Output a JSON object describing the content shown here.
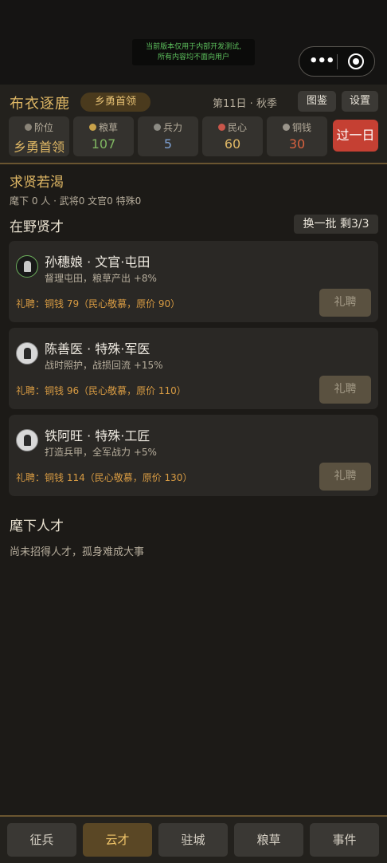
{
  "notice": {
    "line1": "当前版本仅用于内部开发测试,",
    "line2": "所有内容均不面向用户"
  },
  "capsule": {
    "more_icon": "more-dots-icon",
    "close_icon": "target-circle-icon"
  },
  "header": {
    "game_title": "布衣逐鹿",
    "rank_chip": "乡勇首领",
    "day": "第11日 · 秋季",
    "atlas_button": "图鉴",
    "settings_button": "设置"
  },
  "stats": [
    {
      "label": "阶位",
      "value": "乡勇首领",
      "color": "#e0b865",
      "icon": "rank-icon"
    },
    {
      "label": "粮草",
      "value": "107",
      "color": "#7fb561",
      "icon": "grain-icon"
    },
    {
      "label": "兵力",
      "value": "5",
      "color": "#7d9fd0",
      "icon": "troops-icon"
    },
    {
      "label": "民心",
      "value": "60",
      "color": "#e0b865",
      "icon": "morale-icon"
    },
    {
      "label": "铜钱",
      "value": "30",
      "color": "#d9623f",
      "icon": "coin-icon"
    }
  ],
  "next_day_button": "过一日",
  "recruit": {
    "title": "求贤若渴",
    "summary": "麾下 0 人 · 武将0 文官0 特殊0"
  },
  "wild": {
    "title": "在野贤才",
    "refresh_button": "换一批 剩3/3"
  },
  "candidates": [
    {
      "name": "孙穗娘 · 文官·屯田",
      "desc": "督理屯田，粮草产出 +8%",
      "price": "礼聘：铜钱 79（民心敬慕，原价 90）",
      "hire": "礼聘"
    },
    {
      "name": "陈善医 · 特殊·军医",
      "desc": "战时照护，战损回流 +15%",
      "price": "礼聘：铜钱 96（民心敬慕，原价 110）",
      "hire": "礼聘"
    },
    {
      "name": "铁阿旺 · 特殊·工匠",
      "desc": "打造兵甲，全军战力 +5%",
      "price": "礼聘：铜钱 114（民心敬慕，原价 130）",
      "hire": "礼聘"
    }
  ],
  "subordinates": {
    "title": "麾下人才",
    "empty": "尚未招得人才，孤身难成大事"
  },
  "nav": [
    {
      "label": "征兵"
    },
    {
      "label": "云才"
    },
    {
      "label": "驻城"
    },
    {
      "label": "粮草"
    },
    {
      "label": "事件"
    }
  ]
}
